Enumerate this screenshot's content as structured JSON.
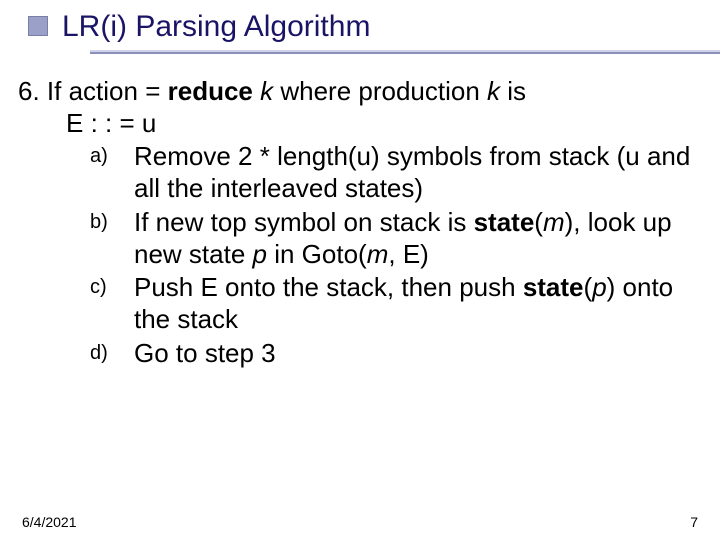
{
  "title": "LR(i) Parsing Algorithm",
  "step": {
    "num": "6.",
    "intro_pre": "If action = ",
    "intro_bold": "reduce",
    "intro_mid1": " ",
    "intro_k1": "k",
    "intro_mid2": " where production ",
    "intro_k2": "k",
    "intro_post": " is",
    "intro_line2": "E : : = u"
  },
  "items": {
    "a": {
      "marker": "a)",
      "t1": "Remove 2 * length(u) symbols from stack (u and all the interleaved states)"
    },
    "b": {
      "marker": "b)",
      "t1": "If new top symbol on stack is ",
      "statew": "state",
      "paren1": "(",
      "m1": "m",
      "paren2": "), look up new state ",
      "p": "p",
      "t2": " in Goto(",
      "m2": "m",
      "t3": ", E)"
    },
    "c": {
      "marker": "c)",
      "t1": "Push E onto the stack, then push ",
      "statew": "state",
      "paren1": "(",
      "p": "p",
      "paren2": ") onto the stack"
    },
    "d": {
      "marker": "d)",
      "t1": "Go to step 3"
    }
  },
  "footer": {
    "date": "6/4/2021",
    "page": "7"
  }
}
